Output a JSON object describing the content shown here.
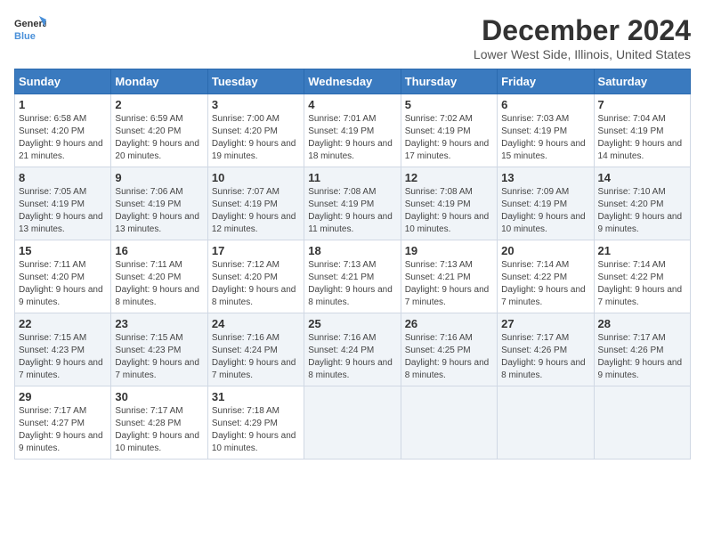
{
  "logo": {
    "general": "General",
    "blue": "Blue"
  },
  "title": "December 2024",
  "subtitle": "Lower West Side, Illinois, United States",
  "days_header": [
    "Sunday",
    "Monday",
    "Tuesday",
    "Wednesday",
    "Thursday",
    "Friday",
    "Saturday"
  ],
  "weeks": [
    [
      {
        "day": "1",
        "sunrise": "6:58 AM",
        "sunset": "4:20 PM",
        "daylight": "9 hours and 21 minutes."
      },
      {
        "day": "2",
        "sunrise": "6:59 AM",
        "sunset": "4:20 PM",
        "daylight": "9 hours and 20 minutes."
      },
      {
        "day": "3",
        "sunrise": "7:00 AM",
        "sunset": "4:20 PM",
        "daylight": "9 hours and 19 minutes."
      },
      {
        "day": "4",
        "sunrise": "7:01 AM",
        "sunset": "4:19 PM",
        "daylight": "9 hours and 18 minutes."
      },
      {
        "day": "5",
        "sunrise": "7:02 AM",
        "sunset": "4:19 PM",
        "daylight": "9 hours and 17 minutes."
      },
      {
        "day": "6",
        "sunrise": "7:03 AM",
        "sunset": "4:19 PM",
        "daylight": "9 hours and 15 minutes."
      },
      {
        "day": "7",
        "sunrise": "7:04 AM",
        "sunset": "4:19 PM",
        "daylight": "9 hours and 14 minutes."
      }
    ],
    [
      {
        "day": "8",
        "sunrise": "7:05 AM",
        "sunset": "4:19 PM",
        "daylight": "9 hours and 13 minutes."
      },
      {
        "day": "9",
        "sunrise": "7:06 AM",
        "sunset": "4:19 PM",
        "daylight": "9 hours and 13 minutes."
      },
      {
        "day": "10",
        "sunrise": "7:07 AM",
        "sunset": "4:19 PM",
        "daylight": "9 hours and 12 minutes."
      },
      {
        "day": "11",
        "sunrise": "7:08 AM",
        "sunset": "4:19 PM",
        "daylight": "9 hours and 11 minutes."
      },
      {
        "day": "12",
        "sunrise": "7:08 AM",
        "sunset": "4:19 PM",
        "daylight": "9 hours and 10 minutes."
      },
      {
        "day": "13",
        "sunrise": "7:09 AM",
        "sunset": "4:19 PM",
        "daylight": "9 hours and 10 minutes."
      },
      {
        "day": "14",
        "sunrise": "7:10 AM",
        "sunset": "4:20 PM",
        "daylight": "9 hours and 9 minutes."
      }
    ],
    [
      {
        "day": "15",
        "sunrise": "7:11 AM",
        "sunset": "4:20 PM",
        "daylight": "9 hours and 9 minutes."
      },
      {
        "day": "16",
        "sunrise": "7:11 AM",
        "sunset": "4:20 PM",
        "daylight": "9 hours and 8 minutes."
      },
      {
        "day": "17",
        "sunrise": "7:12 AM",
        "sunset": "4:20 PM",
        "daylight": "9 hours and 8 minutes."
      },
      {
        "day": "18",
        "sunrise": "7:13 AM",
        "sunset": "4:21 PM",
        "daylight": "9 hours and 8 minutes."
      },
      {
        "day": "19",
        "sunrise": "7:13 AM",
        "sunset": "4:21 PM",
        "daylight": "9 hours and 7 minutes."
      },
      {
        "day": "20",
        "sunrise": "7:14 AM",
        "sunset": "4:22 PM",
        "daylight": "9 hours and 7 minutes."
      },
      {
        "day": "21",
        "sunrise": "7:14 AM",
        "sunset": "4:22 PM",
        "daylight": "9 hours and 7 minutes."
      }
    ],
    [
      {
        "day": "22",
        "sunrise": "7:15 AM",
        "sunset": "4:23 PM",
        "daylight": "9 hours and 7 minutes."
      },
      {
        "day": "23",
        "sunrise": "7:15 AM",
        "sunset": "4:23 PM",
        "daylight": "9 hours and 7 minutes."
      },
      {
        "day": "24",
        "sunrise": "7:16 AM",
        "sunset": "4:24 PM",
        "daylight": "9 hours and 7 minutes."
      },
      {
        "day": "25",
        "sunrise": "7:16 AM",
        "sunset": "4:24 PM",
        "daylight": "9 hours and 8 minutes."
      },
      {
        "day": "26",
        "sunrise": "7:16 AM",
        "sunset": "4:25 PM",
        "daylight": "9 hours and 8 minutes."
      },
      {
        "day": "27",
        "sunrise": "7:17 AM",
        "sunset": "4:26 PM",
        "daylight": "9 hours and 8 minutes."
      },
      {
        "day": "28",
        "sunrise": "7:17 AM",
        "sunset": "4:26 PM",
        "daylight": "9 hours and 9 minutes."
      }
    ],
    [
      {
        "day": "29",
        "sunrise": "7:17 AM",
        "sunset": "4:27 PM",
        "daylight": "9 hours and 9 minutes."
      },
      {
        "day": "30",
        "sunrise": "7:17 AM",
        "sunset": "4:28 PM",
        "daylight": "9 hours and 10 minutes."
      },
      {
        "day": "31",
        "sunrise": "7:18 AM",
        "sunset": "4:29 PM",
        "daylight": "9 hours and 10 minutes."
      },
      null,
      null,
      null,
      null
    ]
  ],
  "labels": {
    "sunrise": "Sunrise:",
    "sunset": "Sunset:",
    "daylight": "Daylight:"
  }
}
